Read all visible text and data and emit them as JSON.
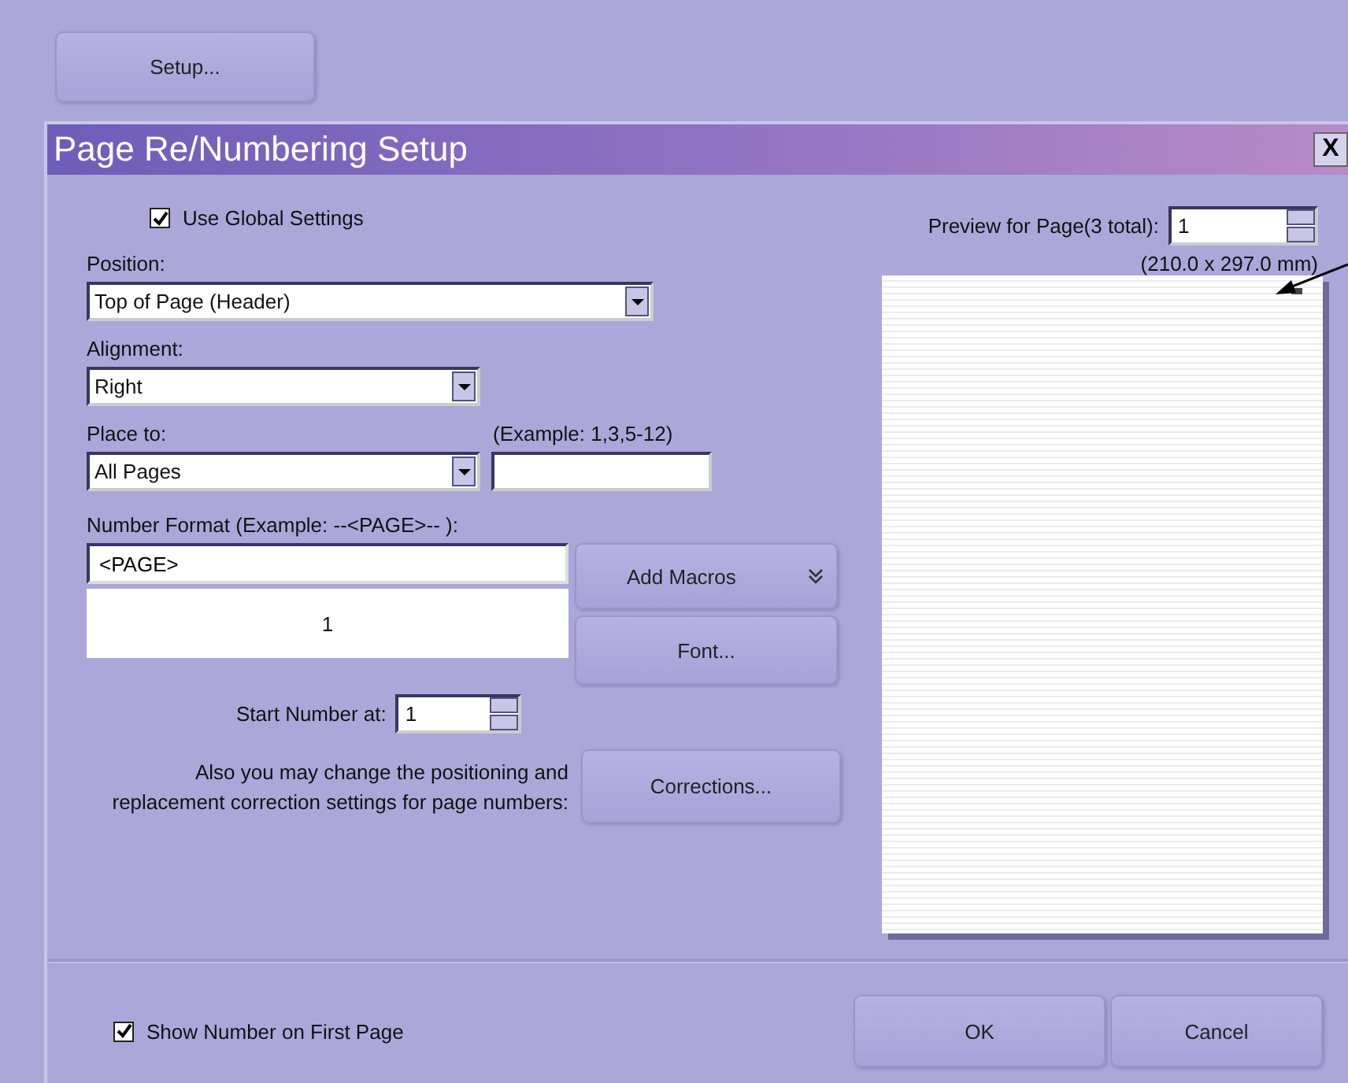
{
  "setup_button": "Setup...",
  "dialog": {
    "title": "Page Re/Numbering Setup",
    "close": "X"
  },
  "use_global_settings": {
    "label": "Use Global Settings",
    "checked": true
  },
  "position": {
    "label": "Position:",
    "value": "Top of Page (Header)"
  },
  "alignment": {
    "label": "Alignment:",
    "value": "Right"
  },
  "place_to": {
    "label": "Place to:",
    "value": "All Pages",
    "example": "(Example: 1,3,5-12)"
  },
  "number_format": {
    "label": "Number Format (Example: --<PAGE>-- ):",
    "value": "<PAGE>",
    "sample": "1"
  },
  "add_macros_button": "Add Macros",
  "font_button": "Font...",
  "start_number": {
    "label": "Start Number at:",
    "value": "1"
  },
  "corrections_note": "Also you may change the positioning and replacement correction settings for page numbers:",
  "corrections_button": "Corrections...",
  "preview": {
    "label": "Preview for Page(3 total):",
    "value": "1",
    "size": "(210.0 x 297.0 mm)"
  },
  "show_number_on_first_page": {
    "label": "Show Number on First Page",
    "checked": true
  },
  "ok_button": "OK",
  "cancel_button": "Cancel"
}
